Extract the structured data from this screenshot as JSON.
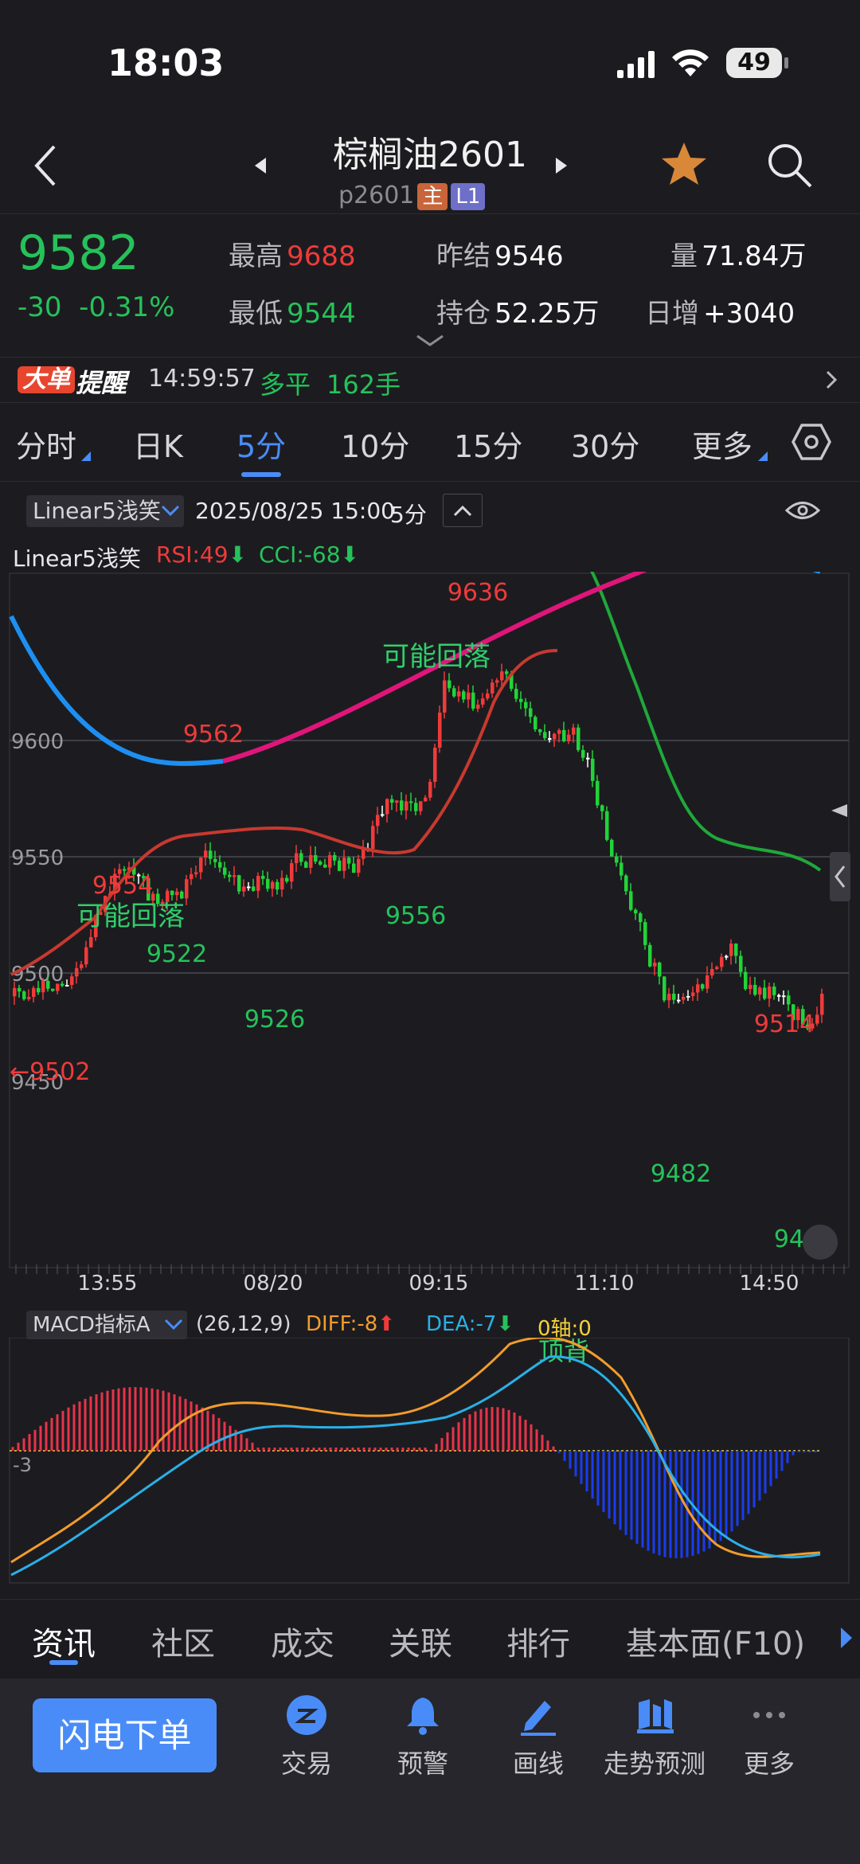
{
  "status_bar": {
    "time": "18:03",
    "battery": "49"
  },
  "header": {
    "title": "棕榈油2601",
    "subtitle": "p2601",
    "tag_main": "主",
    "tag_level": "L1"
  },
  "quote": {
    "price": "9582",
    "change": "-30",
    "change_pct": "-0.31%",
    "high_label": "最高",
    "high": "9688",
    "low_label": "最低",
    "low": "9544",
    "prev_settle_label": "昨结",
    "prev_settle": "9546",
    "open_interest_label": "持仓",
    "open_interest": "52.25万",
    "volume_label": "量",
    "volume": "71.84万",
    "daily_add_label": "日增",
    "daily_add": "+3040"
  },
  "alert": {
    "badge": "大单",
    "label": "提醒",
    "time": "14:59:57",
    "type": "多平",
    "qty": "162手"
  },
  "period_tabs": [
    "分时",
    "日K",
    "5分",
    "10分",
    "15分",
    "30分",
    "更多"
  ],
  "active_period": "5分",
  "chart_toolbar": {
    "indicator": "Linear5浅笑",
    "datetime": "2025/08/25 15:00",
    "period": "5分"
  },
  "indicator_row": {
    "name": "Linear5浅笑",
    "rsi": "RSI:49",
    "cci": "CCI:-68"
  },
  "price_chart": {
    "y_ticks": [
      "9600",
      "9550",
      "9500",
      "9450"
    ],
    "x_ticks": [
      "13:55",
      "08/20",
      "09:15",
      "11:10",
      "14:50"
    ],
    "marks": [
      "9636",
      "9562",
      "9554",
      "9556",
      "9522",
      "9526",
      "9482",
      "9514",
      "9462",
      "←9502"
    ],
    "annotations": [
      "可能回落",
      "可能回落"
    ],
    "colors": {
      "up": "#f03a3a",
      "down": "#22d33a",
      "trend_up": "#e0157a",
      "trend_flat": "#1d8ff2",
      "ma_red": "#c8392f",
      "ma_green": "#20a83a"
    }
  },
  "macd": {
    "name": "MACD指标A",
    "params": "(26,12,9)",
    "diff": "DIFF:-8",
    "dea": "DEA:-7",
    "zero": "0轴:0",
    "annotation": "顶背",
    "y_label": "-3",
    "colors": {
      "diff": "#f39c2b",
      "dea": "#2ab0e8",
      "hist_pos": "#e8334a",
      "hist_neg": "#1a3cf0"
    }
  },
  "info_tabs": [
    "资讯",
    "社区",
    "成交",
    "关联",
    "排行",
    "基本面(F10)"
  ],
  "footer": {
    "order_button": "闪电下单",
    "items": [
      {
        "label": "交易",
        "icon": "trade-icon"
      },
      {
        "label": "预警",
        "icon": "bell-icon"
      },
      {
        "label": "画线",
        "icon": "draw-line-icon"
      },
      {
        "label": "走势预测",
        "icon": "trend-forecast-icon"
      },
      {
        "label": "更多",
        "icon": "more-icon"
      }
    ]
  }
}
